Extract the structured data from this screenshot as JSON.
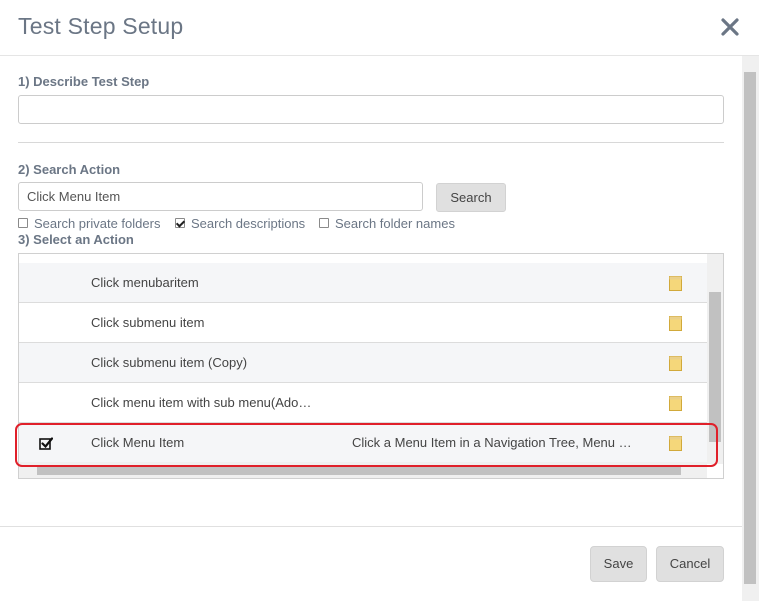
{
  "dialog": {
    "title": "Test Step Setup",
    "close_icon": "close-icon"
  },
  "step1": {
    "label": "1) Describe Test Step",
    "value": ""
  },
  "step2": {
    "label": "2) Search Action",
    "search_value": "Click Menu Item",
    "search_button": "Search",
    "options": [
      {
        "label": "Search private folders",
        "checked": false
      },
      {
        "label": "Search descriptions",
        "checked": true
      },
      {
        "label": "Search folder names",
        "checked": false
      }
    ]
  },
  "step3": {
    "label": "3) Select an Action",
    "rows": [
      {
        "name": "Click menubaritem",
        "description": "",
        "selected": false
      },
      {
        "name": "Click submenu item",
        "description": "",
        "selected": false
      },
      {
        "name": "Click submenu item (Copy)",
        "description": "",
        "selected": false
      },
      {
        "name": "Click menu item with sub menu(Ado…",
        "description": "",
        "selected": false
      },
      {
        "name": "Click Menu Item",
        "description": "Click a Menu Item in a Navigation Tree, Menu …",
        "selected": true
      }
    ],
    "folder_icon": "folder-icon",
    "selected_icon": "checked-checkbox-icon",
    "highlight_color": "#e0202a"
  },
  "footer": {
    "save": "Save",
    "cancel": "Cancel"
  }
}
